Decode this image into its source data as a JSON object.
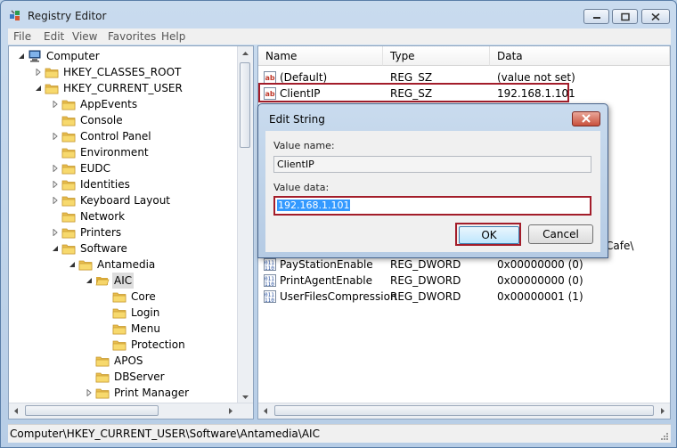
{
  "window": {
    "title": "Registry Editor"
  },
  "menu": [
    "File",
    "Edit",
    "View",
    "Favorites",
    "Help"
  ],
  "tree": [
    {
      "label": "Computer",
      "level": 0,
      "expander": "expanded",
      "icon": "computer"
    },
    {
      "label": "HKEY_CLASSES_ROOT",
      "level": 1,
      "expander": "collapsed",
      "icon": "folder"
    },
    {
      "label": "HKEY_CURRENT_USER",
      "level": 1,
      "expander": "expanded",
      "icon": "folder"
    },
    {
      "label": "AppEvents",
      "level": 2,
      "expander": "collapsed",
      "icon": "folder"
    },
    {
      "label": "Console",
      "level": 2,
      "expander": "none",
      "icon": "folder"
    },
    {
      "label": "Control Panel",
      "level": 2,
      "expander": "collapsed",
      "icon": "folder"
    },
    {
      "label": "Environment",
      "level": 2,
      "expander": "none",
      "icon": "folder"
    },
    {
      "label": "EUDC",
      "level": 2,
      "expander": "collapsed",
      "icon": "folder"
    },
    {
      "label": "Identities",
      "level": 2,
      "expander": "collapsed",
      "icon": "folder"
    },
    {
      "label": "Keyboard Layout",
      "level": 2,
      "expander": "collapsed",
      "icon": "folder"
    },
    {
      "label": "Network",
      "level": 2,
      "expander": "none",
      "icon": "folder"
    },
    {
      "label": "Printers",
      "level": 2,
      "expander": "collapsed",
      "icon": "folder"
    },
    {
      "label": "Software",
      "level": 2,
      "expander": "expanded",
      "icon": "folder"
    },
    {
      "label": "Antamedia",
      "level": 3,
      "expander": "expanded",
      "icon": "folder"
    },
    {
      "label": "AIC",
      "level": 4,
      "expander": "expanded",
      "icon": "folder-open",
      "selected": true
    },
    {
      "label": "Core",
      "level": 5,
      "expander": "none",
      "icon": "folder"
    },
    {
      "label": "Login",
      "level": 5,
      "expander": "none",
      "icon": "folder"
    },
    {
      "label": "Menu",
      "level": 5,
      "expander": "none",
      "icon": "folder"
    },
    {
      "label": "Protection",
      "level": 5,
      "expander": "none",
      "icon": "folder"
    },
    {
      "label": "APOS",
      "level": 4,
      "expander": "none",
      "icon": "folder"
    },
    {
      "label": "DBServer",
      "level": 4,
      "expander": "none",
      "icon": "folder"
    },
    {
      "label": "Print Manager",
      "level": 4,
      "expander": "collapsed",
      "icon": "folder"
    }
  ],
  "list": {
    "headers": {
      "name": "Name",
      "type": "Type",
      "data": "Data"
    },
    "rows": [
      {
        "name": "(Default)",
        "type": "REG_SZ",
        "data": "(value not set)",
        "icon": "string"
      },
      {
        "name": "ClientIP",
        "type": "REG_SZ",
        "data": "192.168.1.101",
        "icon": "string",
        "highlight": true
      },
      {
        "name": "PayStationEnable",
        "type": "REG_DWORD",
        "data": "0x00000000 (0)",
        "icon": "binary"
      },
      {
        "name": "PrintAgentEnable",
        "type": "REG_DWORD",
        "data": "0x00000000 (0)",
        "icon": "binary"
      },
      {
        "name": "UserFilesCompression",
        "type": "REG_DWORD",
        "data": "0x00000001 (1)",
        "icon": "binary"
      }
    ],
    "partial_text": "Cafe\\"
  },
  "dialog": {
    "title": "Edit String",
    "value_name_label": "Value name:",
    "value_name": "ClientIP",
    "value_data_label": "Value data:",
    "value_data": "192.168.1.101",
    "ok_label": "OK",
    "cancel_label": "Cancel"
  },
  "status": {
    "path": "Computer\\HKEY_CURRENT_USER\\Software\\Antamedia\\AIC"
  },
  "colors": {
    "highlight_border": "#a31d2a",
    "selection": "#3399ff"
  }
}
